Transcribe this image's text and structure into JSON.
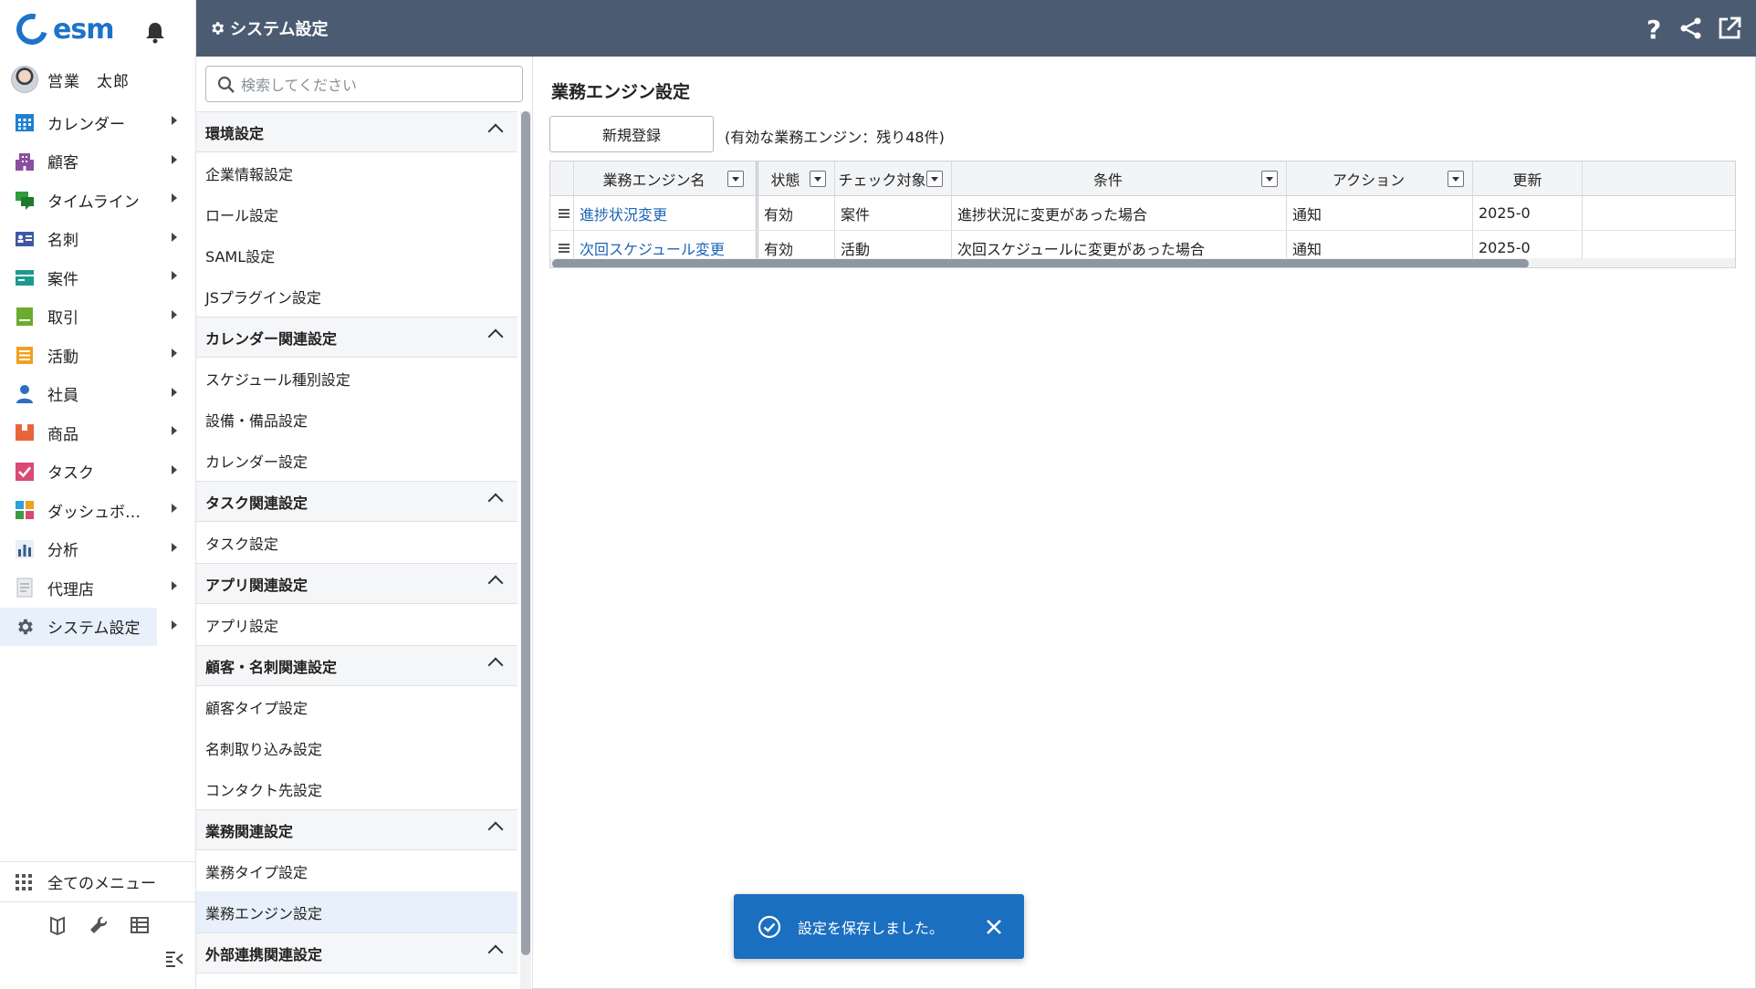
{
  "app": {
    "logo_text": "esm",
    "brand_color": "#1d73c9",
    "header_color": "#4b5b72"
  },
  "user": {
    "name": "営業　太郎"
  },
  "nav": {
    "items": [
      {
        "label": "カレンダー",
        "icon": "calendar-icon",
        "color": "#1f7fd1"
      },
      {
        "label": "顧客",
        "icon": "building-icon",
        "color": "#8a4f9e"
      },
      {
        "label": "タイムライン",
        "icon": "chat-icon",
        "color": "#2e9d3f"
      },
      {
        "label": "名刺",
        "icon": "card-icon",
        "color": "#3f58a6"
      },
      {
        "label": "案件",
        "icon": "briefcase-icon",
        "color": "#1e9a8c"
      },
      {
        "label": "取引",
        "icon": "document-icon",
        "color": "#6cab2f"
      },
      {
        "label": "活動",
        "icon": "clipboard-icon",
        "color": "#f0a020"
      },
      {
        "label": "社員",
        "icon": "person-icon",
        "color": "#2a6fc2"
      },
      {
        "label": "商品",
        "icon": "box-icon",
        "color": "#e8653a"
      },
      {
        "label": "タスク",
        "icon": "checkbox-icon",
        "color": "#d94a75"
      },
      {
        "label": "ダッシュボ…",
        "icon": "dashboard-icon",
        "color": "#2ea1d9"
      },
      {
        "label": "分析",
        "icon": "chart-icon",
        "color": "#335c88"
      },
      {
        "label": "代理店",
        "icon": "page-icon",
        "color": "#b8bcc2"
      },
      {
        "label": "システム設定",
        "icon": "gear-icon",
        "color": "#555c66"
      }
    ],
    "all_menu": "全てのメニュー"
  },
  "header": {
    "title": "システム設定"
  },
  "settings": {
    "search_placeholder": "検索してください",
    "sections": [
      {
        "title": "環境設定",
        "items": [
          "企業情報設定",
          "ロール設定",
          "SAML設定",
          "JSプラグイン設定"
        ]
      },
      {
        "title": "カレンダー関連設定",
        "items": [
          "スケジュール種別設定",
          "設備・備品設定",
          "カレンダー設定"
        ]
      },
      {
        "title": "タスク関連設定",
        "items": [
          "タスク設定"
        ]
      },
      {
        "title": "アプリ関連設定",
        "items": [
          "アプリ設定"
        ]
      },
      {
        "title": "顧客・名刺関連設定",
        "items": [
          "顧客タイプ設定",
          "名刺取り込み設定",
          "コンタクト先設定"
        ]
      },
      {
        "title": "業務関連設定",
        "items": [
          "業務タイプ設定",
          "業務エンジン設定"
        ]
      },
      {
        "title": "外部連携関連設定",
        "items": []
      }
    ]
  },
  "main": {
    "title": "業務エンジン設定",
    "new_button": "新規登録",
    "remaining": "(有効な業務エンジン：残り48件)",
    "columns": [
      "業務エンジン名",
      "状態",
      "チェック対象",
      "条件",
      "アクション",
      "更新"
    ],
    "rows": [
      [
        "進捗状況変更",
        "有効",
        "案件",
        "進捗状況に変更があった場合",
        "通知",
        "2025-0"
      ],
      [
        "次回スケジュール変更",
        "有効",
        "活動",
        "次回スケジュールに変更があった場合",
        "通知",
        "2025-0"
      ]
    ]
  },
  "toast": {
    "message": "設定を保存しました。"
  }
}
